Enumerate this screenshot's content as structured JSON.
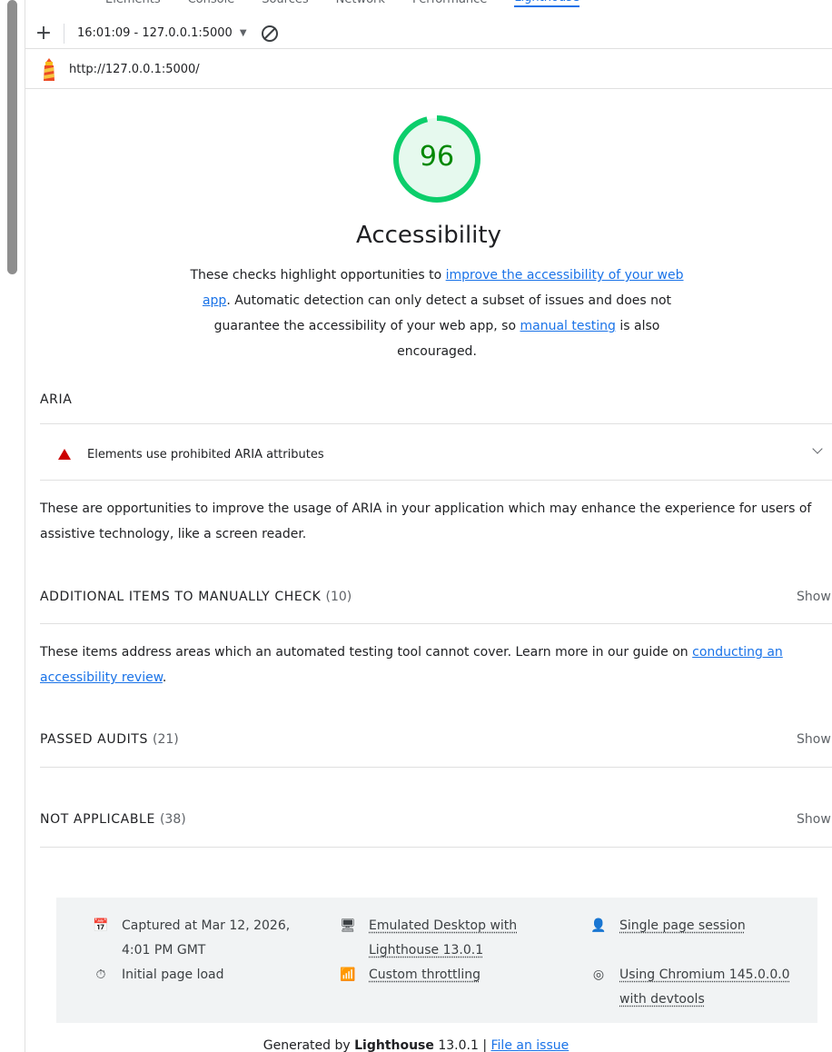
{
  "devtools": {
    "tabs": [
      {
        "label": "Elements",
        "active": false
      },
      {
        "label": "Console",
        "active": false
      },
      {
        "label": "Sources",
        "active": false
      },
      {
        "label": "Network",
        "active": false
      },
      {
        "label": "Performance",
        "active": false
      },
      {
        "label": "Lighthouse",
        "active": true
      }
    ]
  },
  "toolbar": {
    "add_icon": "plus-icon",
    "report_label": "16:01:09 - 127.0.0.1:5000",
    "clear_icon": "block-icon"
  },
  "urlbar": {
    "logo_icon": "lighthouse-icon",
    "url": "http://127.0.0.1:5000/"
  },
  "score": {
    "value": 96,
    "color": "#0cce6b",
    "text_color": "#008800"
  },
  "category": {
    "title": "Accessibility",
    "desc_1": "These checks highlight opportunities to ",
    "desc_link_1": "improve the accessibility of your web app",
    "desc_2": ". Automatic detection can only detect a subset of issues and does not guarantee the accessibility of your web app, so ",
    "desc_link_2": "manual testing",
    "desc_3": " is also encouraged."
  },
  "aria": {
    "heading": "ARIA",
    "audit_title": "Elements use prohibited ARIA attributes",
    "audit_icon": "fail-triangle-icon",
    "description": "These are opportunities to improve the usage of ARIA in your application which may enhance the experience for users of assistive technology, like a screen reader."
  },
  "manual": {
    "heading": "ADDITIONAL ITEMS TO MANUALLY CHECK",
    "count": "(10)",
    "show": "Show",
    "desc": "These items address areas which an automated testing tool cannot cover. Learn more in our guide on ",
    "desc_link": "conducting an accessibility review",
    "desc_end": "."
  },
  "passed": {
    "heading": "PASSED AUDITS",
    "count": "(21)",
    "show": "Show"
  },
  "not_applicable": {
    "heading": "NOT APPLICABLE",
    "count": "(38)",
    "show": "Show"
  },
  "env": {
    "captured_icon": "calendar-icon",
    "captured_1": "Captured at Mar 12, 2026,",
    "captured_2": "4:01 PM GMT",
    "initial_icon": "stopwatch-icon",
    "initial": "Initial page load",
    "emulated_icon": "devices-icon",
    "emulated_1": "Emulated Desktop with",
    "emulated_2": "Lighthouse 13.0.1",
    "throttle_icon": "network-icon",
    "throttle": "Custom throttling",
    "session_icon": "person-icon",
    "session": "Single page session",
    "chromium_icon": "chrome-icon",
    "chromium_1": "Using Chromium 145.0.0.0",
    "chromium_2": "with devtools"
  },
  "footer": {
    "prefix": "Generated by ",
    "brand": "Lighthouse",
    "version": " 13.0.1 | ",
    "issue_link": "File an issue"
  }
}
